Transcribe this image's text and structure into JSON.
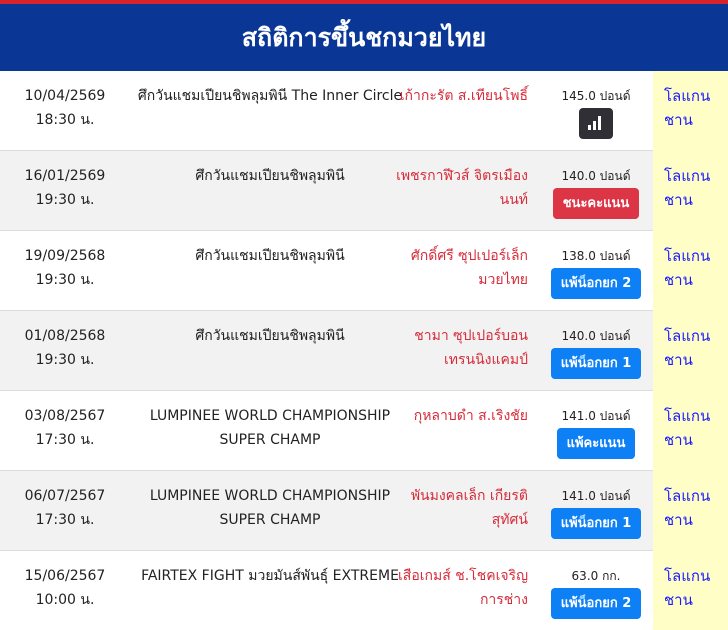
{
  "header": {
    "title": "สถิติการขึ้นชกมวยไทย"
  },
  "fights": [
    {
      "date": "10/04/2569",
      "time": "18:30 น.",
      "event": "ศึกวันแชมเปียนชิพลุมพินี The Inner Circle",
      "opponent": "เก้ากะรัต ส.เทียนโพธิ์",
      "weight": "145.0 ปอนด์",
      "result_type": "stat",
      "result": "",
      "corner": "โลแกนชาน"
    },
    {
      "date": "16/01/2569",
      "time": "19:30 น.",
      "event": "ศึกวันแชมเปียนชิพลุมพินี",
      "opponent": "เพชรกาฬีวส์ จิตรเมืองนนท์",
      "weight": "140.0 ปอนด์",
      "result_type": "win",
      "result": "ชนะคะแนน",
      "corner": "โลแกนชาน"
    },
    {
      "date": "19/09/2568",
      "time": "19:30 น.",
      "event": "ศึกวันแชมเปียนชิพลุมพินี",
      "opponent": "ศักดิ์ศรี ซุปเปอร์เล็กมวยไทย",
      "weight": "138.0 ปอนด์",
      "result_type": "loss",
      "result": "แพ้น็อกยก 2",
      "corner": "โลแกนชาน"
    },
    {
      "date": "01/08/2568",
      "time": "19:30 น.",
      "event": "ศึกวันแชมเปียนชิพลุมพินี",
      "opponent": "ชามา ซุปเปอร์บอนเทรนนิงแคมป์",
      "weight": "140.0 ปอนด์",
      "result_type": "loss",
      "result": "แพ้น็อกยก 1",
      "corner": "โลแกนชาน"
    },
    {
      "date": "03/08/2567",
      "time": "17:30 น.",
      "event": "LUMPINEE WORLD CHAMPIONSHIP SUPER CHAMP",
      "opponent": "กุหลาบดำ ส.เริงชัย",
      "weight": "141.0 ปอนด์",
      "result_type": "loss",
      "result": "แพ้คะแนน",
      "corner": "โลแกนชาน"
    },
    {
      "date": "06/07/2567",
      "time": "17:30 น.",
      "event": "LUMPINEE WORLD CHAMPIONSHIP SUPER CHAMP",
      "opponent": "พันมงคลเล็ก เกียรติสุทัศน์",
      "weight": "141.0 ปอนด์",
      "result_type": "loss",
      "result": "แพ้น็อกยก 1",
      "corner": "โลแกนชาน"
    },
    {
      "date": "15/06/2567",
      "time": "10:00 น.",
      "event": "FAIRTEX FIGHT มวยมันส์พันธุ์ EXTREME",
      "opponent": "เสือเกมส์ ช.โชคเจริญการช่าง",
      "weight": "63.0 กก.",
      "result_type": "loss",
      "result": "แพ้น็อกยก 2",
      "corner": "โลแกนชาน"
    }
  ],
  "colors": {
    "header_bg": "#0a3696",
    "accent_red": "#d62c3a",
    "win": "#dc3545",
    "loss": "#0d80f5",
    "corner_bg": "#fefec6",
    "corner_text": "#1a1aff"
  },
  "icons": {
    "stat_icon": "bar-chart-icon"
  }
}
